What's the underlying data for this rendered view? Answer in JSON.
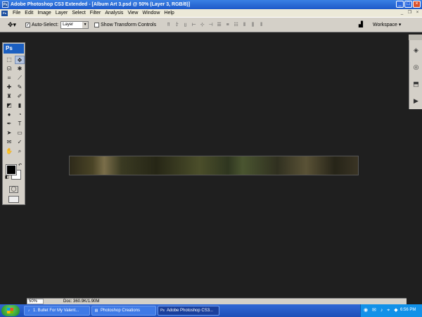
{
  "window": {
    "title": "Adobe Photoshop CS3 Extended - [Album Art 3.psd @ 50% (Layer 3, RGB/8)]",
    "app_logo": "Ps",
    "controls": {
      "minimize": "_",
      "maximize": "□",
      "close": "×"
    }
  },
  "menubar": {
    "items": [
      "File",
      "Edit",
      "Image",
      "Layer",
      "Select",
      "Filter",
      "Analysis",
      "View",
      "Window",
      "Help"
    ],
    "doc_controls": {
      "minimize": "_",
      "restore": "❐",
      "close": "×"
    }
  },
  "options": {
    "auto_select_label": "Auto-Select:",
    "auto_select_checked": "✓",
    "auto_select_value": "Layer",
    "show_transform_label": "Show Transform Controls",
    "workspace_label": "Workspace ▾"
  },
  "tools": {
    "header": "Ps",
    "items": [
      {
        "name": "marquee-tool",
        "glyph": "⬚"
      },
      {
        "name": "move-tool",
        "glyph": "✥"
      },
      {
        "name": "lasso-tool",
        "glyph": "ᘏ"
      },
      {
        "name": "magic-wand-tool",
        "glyph": "✱"
      },
      {
        "name": "crop-tool",
        "glyph": "⌗"
      },
      {
        "name": "slice-tool",
        "glyph": "⟋"
      },
      {
        "name": "healing-tool",
        "glyph": "✚"
      },
      {
        "name": "brush-tool",
        "glyph": "✎"
      },
      {
        "name": "stamp-tool",
        "glyph": "♜"
      },
      {
        "name": "history-brush-tool",
        "glyph": "✐"
      },
      {
        "name": "eraser-tool",
        "glyph": "◩"
      },
      {
        "name": "gradient-tool",
        "glyph": "▮"
      },
      {
        "name": "blur-tool",
        "glyph": "●"
      },
      {
        "name": "dodge-tool",
        "glyph": "◔"
      },
      {
        "name": "pen-tool",
        "glyph": "✒"
      },
      {
        "name": "type-tool",
        "glyph": "T"
      },
      {
        "name": "path-select-tool",
        "glyph": "➤"
      },
      {
        "name": "shape-tool",
        "glyph": "▭"
      },
      {
        "name": "notes-tool",
        "glyph": "✉"
      },
      {
        "name": "eyedropper-tool",
        "glyph": "✓"
      },
      {
        "name": "hand-tool",
        "glyph": "✋"
      },
      {
        "name": "zoom-tool",
        "glyph": "⌕"
      }
    ],
    "swap_glyph": "↶",
    "reset_glyph": "◧",
    "mask_glyph": "◯"
  },
  "dock": {
    "icons": [
      "◈",
      "◎",
      "⬒",
      "▶"
    ]
  },
  "status": {
    "zoom": "50%",
    "doc": "Doc: 360.9K/1.90M"
  },
  "taskbar": {
    "tasks": [
      {
        "label": "1. Bullet For My Valent...",
        "icon": "♪"
      },
      {
        "label": "Photoshop Creations",
        "icon": "▤"
      },
      {
        "label": "Adobe Photoshop CS3...",
        "icon": "Ps"
      }
    ],
    "tray_icons": "◉ ✉ ♪ ⌖ ◆",
    "clock": "6:56 PM"
  },
  "colors": {
    "canvas_bg": "#1f1f1f",
    "titlebar": "#1e59c9",
    "taskbar": "#245edb",
    "foreground_swatch": "#000000",
    "background_swatch": "#ffffff"
  }
}
